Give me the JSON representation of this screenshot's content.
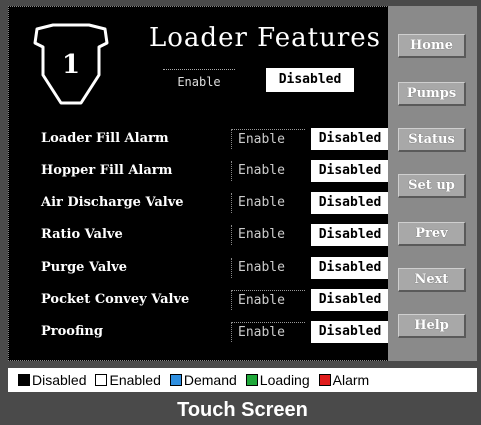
{
  "header": {
    "title": "Loader Features",
    "loader_number": "1",
    "enable_label": "Enable",
    "master_value": "Disabled"
  },
  "nav": {
    "home": "Home",
    "pumps": "Pumps",
    "status": "Status",
    "setup": "Set up",
    "prev": "Prev",
    "next": "Next",
    "help": "Help"
  },
  "features": [
    {
      "label": "Loader Fill Alarm",
      "enable": "Enable",
      "value": "Disabled"
    },
    {
      "label": "Hopper Fill Alarm",
      "enable": "Enable",
      "value": "Disabled"
    },
    {
      "label": "Air Discharge Valve",
      "enable": "Enable",
      "value": "Disabled"
    },
    {
      "label": "Ratio Valve",
      "enable": "Enable",
      "value": "Disabled"
    },
    {
      "label": "Purge Valve",
      "enable": "Enable",
      "value": "Disabled"
    },
    {
      "label": "Pocket Convey Valve",
      "enable": "Enable",
      "value": "Disabled"
    },
    {
      "label": "Proofing",
      "enable": "Enable",
      "value": "Disabled"
    }
  ],
  "legend": [
    {
      "label": "Disabled",
      "color": "#000000"
    },
    {
      "label": "Enabled",
      "color": "#ffffff"
    },
    {
      "label": "Demand",
      "color": "#2f8fe0"
    },
    {
      "label": "Loading",
      "color": "#1fa83a"
    },
    {
      "label": "Alarm",
      "color": "#e01c1c"
    }
  ],
  "footer": "Touch Screen"
}
